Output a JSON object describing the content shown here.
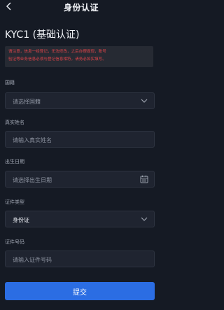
{
  "header": {
    "title": "身份认证"
  },
  "kyc_title": "KYC1 (基础认证)",
  "warning": {
    "line1": "请注意，信息一经登记，无法修改，之后办理提现，账号",
    "line2": "验证等业务信息必须与登记信息相符，请务必如实填写。"
  },
  "form": {
    "nationality": {
      "label": "国籍",
      "placeholder": "请选择国籍"
    },
    "real_name": {
      "label": "真实姓名",
      "placeholder": "请输入真实姓名"
    },
    "birth_date": {
      "label": "出生日期",
      "placeholder": "请选择出生日期"
    },
    "id_type": {
      "label": "证件类型",
      "value": "身份证"
    },
    "id_number": {
      "label": "证件号码",
      "placeholder": "请输入证件号码"
    }
  },
  "submit_label": "提交",
  "colors": {
    "background": "#151a24",
    "warning_text": "#e2454a",
    "primary": "#2b6de3"
  }
}
